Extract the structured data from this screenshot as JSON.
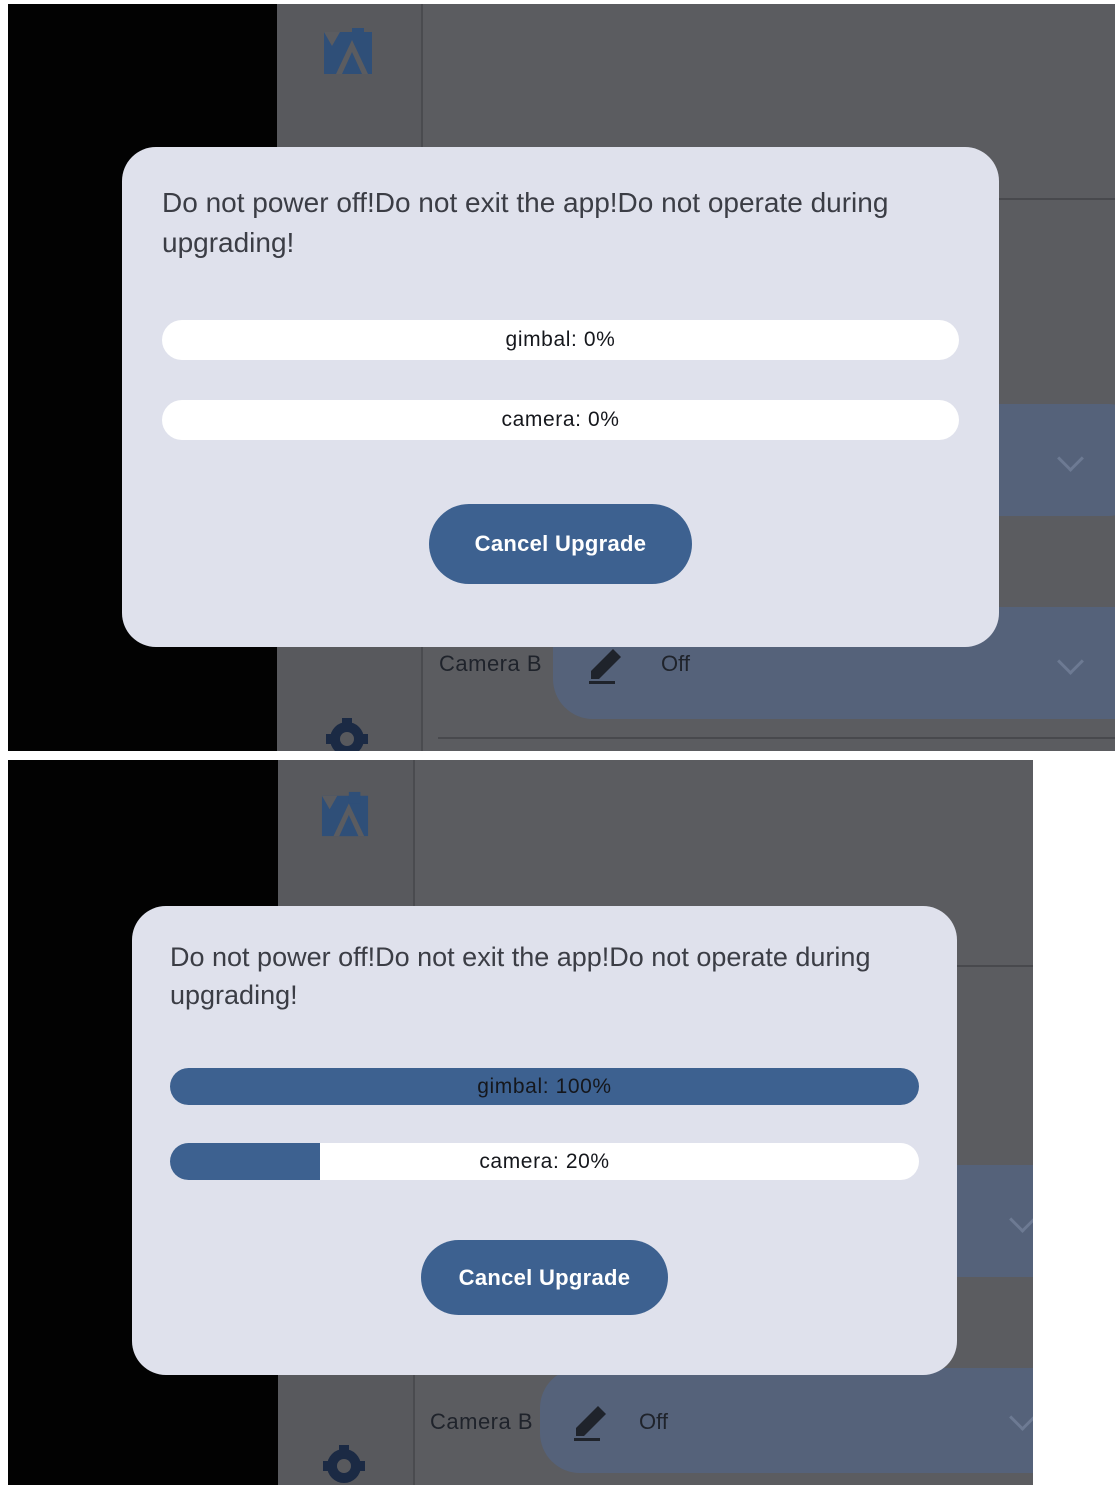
{
  "screens": [
    {
      "dialog": {
        "message": "Do not power off!Do not exit the app!Do not operate during upgrading!",
        "progress": [
          {
            "name": "gimbal",
            "label": "gimbal: 0%",
            "percent": 0
          },
          {
            "name": "camera",
            "label": "camera: 0%",
            "percent": 0
          }
        ],
        "cancel_label": "Cancel Upgrade"
      },
      "background": {
        "camera_label": "Camera B",
        "mode_value": "Off"
      }
    },
    {
      "dialog": {
        "message": "Do not power off!Do not exit the app!Do not operate during upgrading!",
        "progress": [
          {
            "name": "gimbal",
            "label": "gimbal: 100%",
            "percent": 100
          },
          {
            "name": "camera",
            "label": "camera: 20%",
            "percent": 20
          }
        ],
        "cancel_label": "Cancel Upgrade"
      },
      "background": {
        "camera_label": "Camera B",
        "mode_value": "Off"
      }
    }
  ],
  "colors": {
    "accent": "#3d6190",
    "dialog_bg": "#dfe1ec",
    "backdrop": "#5b5c60"
  },
  "icons": [
    "gallery-icon",
    "pencil-icon",
    "gear-icon",
    "chevron-down-icon"
  ]
}
